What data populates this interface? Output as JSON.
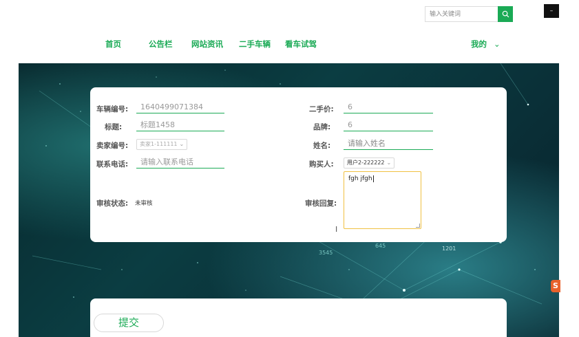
{
  "search": {
    "placeholder": "输入关键词"
  },
  "window": {
    "minimize_label": "–"
  },
  "nav": {
    "items": [
      {
        "label": "首页"
      },
      {
        "label": "公告栏"
      },
      {
        "label": "网站资讯"
      },
      {
        "label": "二手车辆"
      },
      {
        "label": "看车试驾"
      }
    ],
    "mine": "我的",
    "mine_chevron": "⌄"
  },
  "form": {
    "vehicle_no": {
      "label": "车辆编号:",
      "value": "1640499071384"
    },
    "title": {
      "label": "标题:",
      "value": "标题1458"
    },
    "seller_no": {
      "label": "卖家编号:",
      "value": "卖家1-111111"
    },
    "phone": {
      "label": "联系电话:",
      "placeholder": "请输入联系电话"
    },
    "audit_status": {
      "label": "审核状态:",
      "value": "未审核"
    },
    "used_price": {
      "label": "二手价:",
      "value": "6"
    },
    "brand": {
      "label": "品牌:",
      "value": "6"
    },
    "name": {
      "label": "姓名:",
      "placeholder": "请输入姓名"
    },
    "buyer": {
      "label": "购买人:",
      "value": "用户2-222222"
    },
    "audit_reply": {
      "label": "审核回复:",
      "value": "fgh jfgh"
    }
  },
  "actions": {
    "submit_label": "提交"
  },
  "hero": {
    "numbers": [
      "3545",
      "645",
      "1201"
    ]
  },
  "brand_badge": "S",
  "colors": {
    "accent": "#1aaa55",
    "focus_border": "#f0c040",
    "hero_dark": "#07262b"
  }
}
